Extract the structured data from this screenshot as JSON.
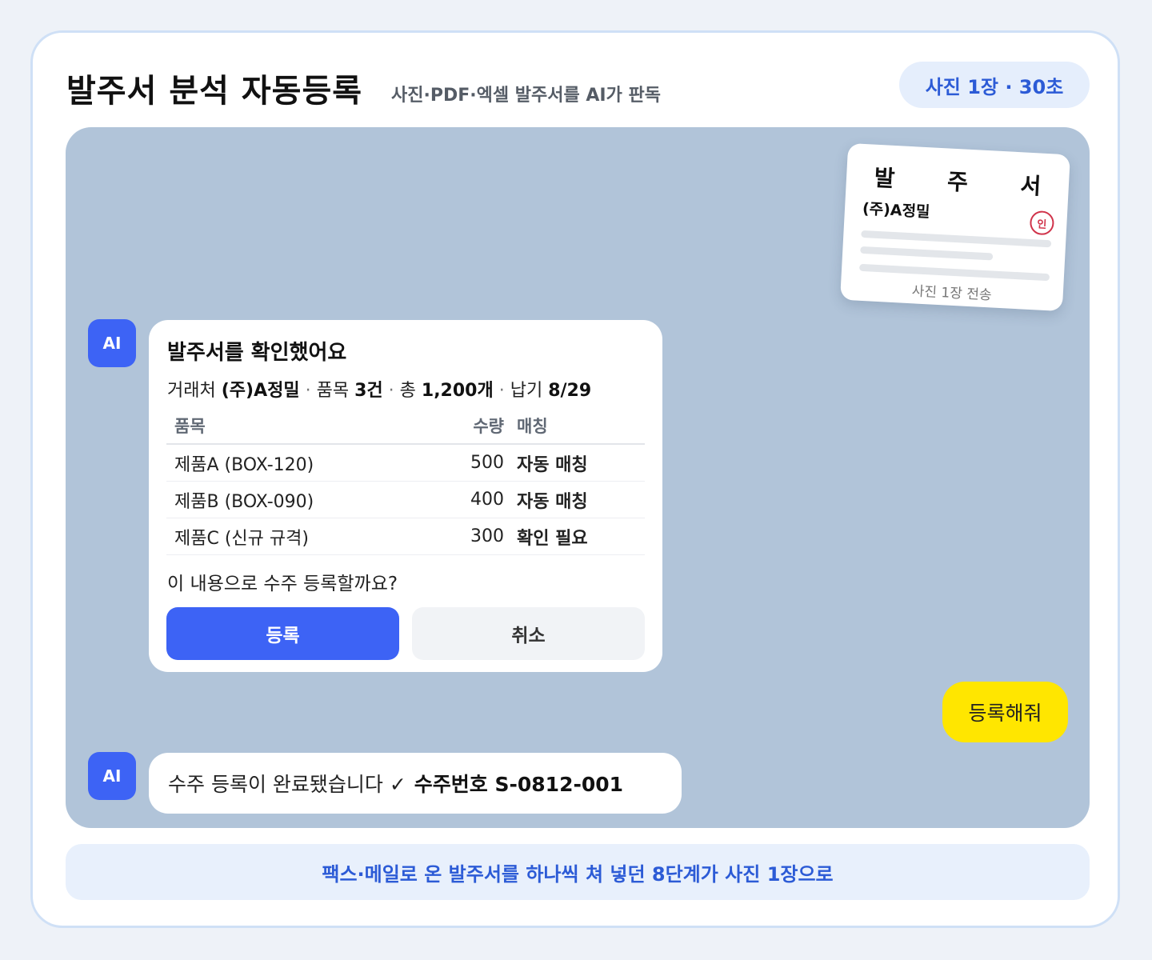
{
  "header": {
    "title": "발주서 분석 자동등록",
    "subtitle": "사진·PDF·엑셀 발주서를 AI가 판독",
    "badge": "사진 1장 · 30초"
  },
  "document_preview": {
    "title": "발 주 서",
    "company": "(주)A정밀",
    "stamp": "인",
    "caption": "사진 1장 전송"
  },
  "ai_avatar_label": "AI",
  "ai_message_1": {
    "title": "발주서를 확인했어요",
    "summary": {
      "vendor_label": "거래처",
      "vendor": "(주)A정밀",
      "items_label": "품목",
      "items_count": "3건",
      "total_label": "총",
      "total_qty": "1,200개",
      "due_label": "납기",
      "due_date": "8/29",
      "separator": "·"
    },
    "table": {
      "headers": {
        "item": "품목",
        "qty": "수량",
        "match": "매칭"
      },
      "rows": [
        {
          "item": "제품A (BOX-120)",
          "qty": "500",
          "match": "자동 매칭",
          "status": "ok"
        },
        {
          "item": "제품B (BOX-090)",
          "qty": "400",
          "match": "자동 매칭",
          "status": "ok"
        },
        {
          "item": "제품C (신규 규격)",
          "qty": "300",
          "match": "확인 필요",
          "status": "warn"
        }
      ]
    },
    "question": "이 내용으로 수주 등록할까요?",
    "confirm_button": "등록",
    "cancel_button": "취소"
  },
  "user_message": "등록해줘",
  "ai_message_2": {
    "text": "수주 등록이 완료됐습니다 ✓",
    "order_number": "수주번호 S-0812-001"
  },
  "footer": "팩스·메일로 온 발주서를 하나씩 쳐 넣던 8단계가 사진 1장으로",
  "colors": {
    "accent": "#3d63f5",
    "chat_background": "#b1c4d9",
    "user_bubble": "#ffe600",
    "match_ok": "#1e8a4a",
    "match_warn": "#c1501d",
    "badge_text": "#2c5bd6"
  }
}
